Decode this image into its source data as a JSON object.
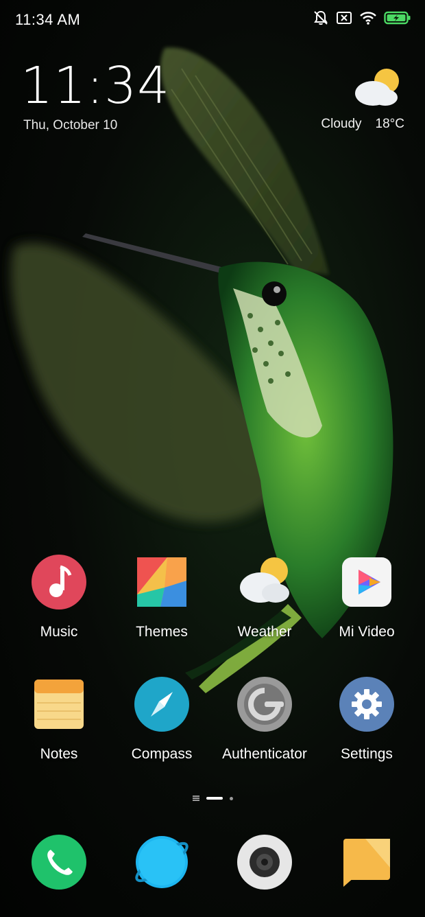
{
  "status_bar": {
    "time": "11:34 AM",
    "icons": [
      "notifications-off-icon",
      "sim-blocked-icon",
      "wifi-icon",
      "battery-charging-icon"
    ],
    "battery_color": "#4cd964"
  },
  "clock_widget": {
    "time": "11:34",
    "date": "Thu, October 10"
  },
  "weather_widget": {
    "condition": "Cloudy",
    "temperature": "18°C",
    "icon": "partly-cloudy-icon"
  },
  "apps": [
    {
      "label": "Music",
      "icon": "music-icon",
      "color": "#e0475b"
    },
    {
      "label": "Themes",
      "icon": "themes-icon",
      "color": "#ef5350"
    },
    {
      "label": "Weather",
      "icon": "weather-icon",
      "color": "#f5c542"
    },
    {
      "label": "Mi Video",
      "icon": "mi-video-icon",
      "color": "#ffffff"
    },
    {
      "label": "Notes",
      "icon": "notes-icon",
      "color": "#f6b94a"
    },
    {
      "label": "Compass",
      "icon": "compass-icon",
      "color": "#1fa6c9"
    },
    {
      "label": "Authenticator",
      "icon": "authenticator-icon",
      "color": "#8a8a8a"
    },
    {
      "label": "Settings",
      "icon": "settings-icon",
      "color": "#5b82b8"
    }
  ],
  "page_indicator": {
    "pages": 2,
    "current": 1
  },
  "dock": [
    {
      "icon": "phone-icon",
      "color": "#1fc26b"
    },
    {
      "icon": "browser-icon",
      "color": "#1eb6f0"
    },
    {
      "icon": "camera-icon",
      "color": "#e6e6e6"
    },
    {
      "icon": "messaging-icon",
      "color": "#f6b94a"
    }
  ]
}
